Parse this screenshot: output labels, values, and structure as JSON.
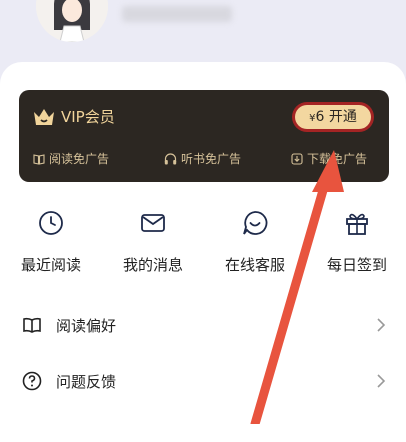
{
  "vip": {
    "title": "VIP会员",
    "button_currency": "¥",
    "button_price": "6",
    "button_action": "开通",
    "perks": [
      "阅读免广告",
      "听书免广告",
      "下载免广告"
    ]
  },
  "shortcuts": [
    {
      "label": "最近阅读",
      "icon": "clock-icon"
    },
    {
      "label": "我的消息",
      "icon": "mail-icon"
    },
    {
      "label": "在线客服",
      "icon": "chat-smile-icon"
    },
    {
      "label": "每日签到",
      "icon": "gift-icon"
    }
  ],
  "menu": [
    {
      "label": "阅读偏好",
      "icon": "book-open-icon"
    },
    {
      "label": "问题反馈",
      "icon": "help-circle-icon"
    }
  ],
  "colors": {
    "vip_bg": "#2c2722",
    "vip_gold": "#f1d49b",
    "annotation_red": "#e8543e"
  }
}
